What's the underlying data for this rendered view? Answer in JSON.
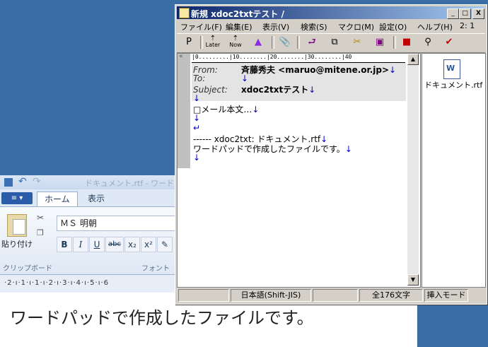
{
  "wordpad": {
    "title": "ドキュメント.rtf - ワード",
    "file_button": "≡ ▾",
    "tabs": [
      "ホーム",
      "表示"
    ],
    "paste_label": "貼り付け",
    "clipboard_group": "クリップボード",
    "font_name": "ＭＳ 明朝",
    "format_buttons": [
      "B",
      "I",
      "U",
      "abc",
      "x₂",
      "x²"
    ],
    "font_group": "フォント",
    "ruler": "·2·ı·1·ı·1·ı·2·ı·3·ı·4·ı·5·ı·6",
    "document_text": "ワードパッドで作成したファイルです。"
  },
  "mail_window": {
    "title": "新規  xdoc2txtテスト /",
    "window_buttons": [
      "_",
      "□",
      "X"
    ],
    "menu": [
      "ファイル(F)",
      "編集(E)",
      "表示(V)",
      "検索(S)",
      "マクロ(M)",
      "設定(O)",
      "ヘルプ(H)",
      "2: 1"
    ],
    "toolbar": {
      "p": "P",
      "later_label": "Later",
      "now_label": "Now"
    },
    "ruler": "|0.........|10........|20........|30........|40",
    "header": {
      "from_label": "From:",
      "from_value": "斉藤秀夫 <maruo@mitene.or.jp>",
      "to_label": "To:",
      "subject_label": "Subject:",
      "subject_value": "xdoc2txtテスト"
    },
    "body_lines": [
      "□メール本文…",
      "",
      "",
      "------ xdoc2txt: ドキュメント.rtf",
      "ワードパッドで作成したファイルです。"
    ],
    "attachment_name": "ドキュメント.rtf",
    "status": {
      "encoding": "日本語(Shift-JIS)",
      "char_count": "全176文字",
      "mode": "挿入モード"
    },
    "colors": {
      "title_start": "#0a246a",
      "title_end": "#a6caf0",
      "newline_mark": "#0000c0"
    }
  }
}
